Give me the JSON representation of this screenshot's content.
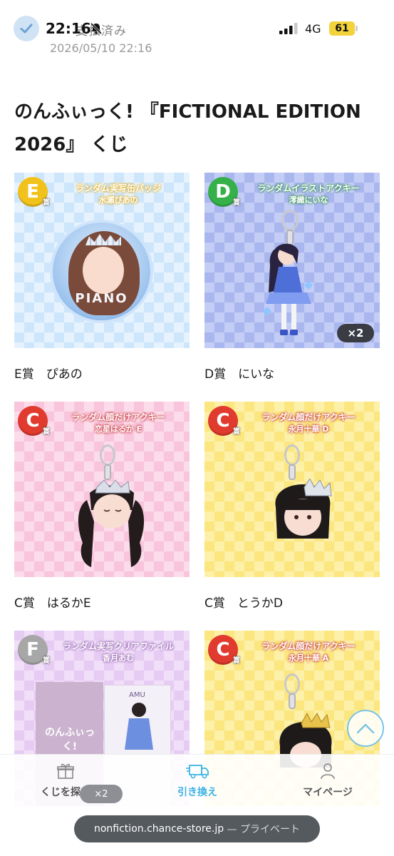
{
  "status_bar": {
    "clock": "22:16",
    "network": "4G",
    "battery": "61",
    "behind_text": "支払済み"
  },
  "order": {
    "date": "2026/05/10 22:16"
  },
  "page": {
    "title": "のんふぃっく! 『FICTIONAL EDITION 2026』 くじ"
  },
  "prizes": [
    {
      "rank": "E",
      "rank_suffix": "賞",
      "title": "ランダム実写缶バッジ",
      "sub": "水瀬ぴあの",
      "caption": "E賞　ぴあの",
      "badge_text": "PIANO",
      "color": "#f2c21c"
    },
    {
      "rank": "D",
      "rank_suffix": "賞",
      "title": "ランダムイラストアクキー",
      "sub": "澪織にいな",
      "caption": "D賞　にいな",
      "qty": "×2",
      "color": "#36b14a"
    },
    {
      "rank": "C",
      "rank_suffix": "賞",
      "title": "ランダム顔だけアクキー",
      "sub": "恋星はるか E",
      "caption": "C賞　はるかE",
      "color": "#e13a2e"
    },
    {
      "rank": "C",
      "rank_suffix": "賞",
      "title": "ランダム顔だけアクキー",
      "sub": "永月十華 D",
      "caption": "C賞　とうかD",
      "color": "#e13a2e"
    },
    {
      "rank": "F",
      "rank_suffix": "賞",
      "title": "ランダム実写クリアファイル",
      "sub": "香月あむ",
      "caption": "",
      "file_logo": "のんふぃっく!",
      "file_name": "AMU",
      "color": "#a7a7a7"
    },
    {
      "rank": "C",
      "rank_suffix": "賞",
      "title": "ランダム顔だけアクキー",
      "sub": "永月十華 A",
      "caption": "",
      "color": "#e13a2e"
    }
  ],
  "bottom_nav": {
    "items": [
      {
        "label": "くじを探す",
        "icon": "gift-icon"
      },
      {
        "label": "引き換え",
        "icon": "truck-icon",
        "active": true
      },
      {
        "label": "マイページ",
        "icon": "person-icon"
      }
    ],
    "peek_badge": "×2"
  },
  "browser": {
    "url": "nonfiction.chance-store.jp",
    "mode": " — プライベート"
  },
  "colors": {
    "accent": "#3bb2e3",
    "scroll_top_border": "#79c3e4"
  }
}
